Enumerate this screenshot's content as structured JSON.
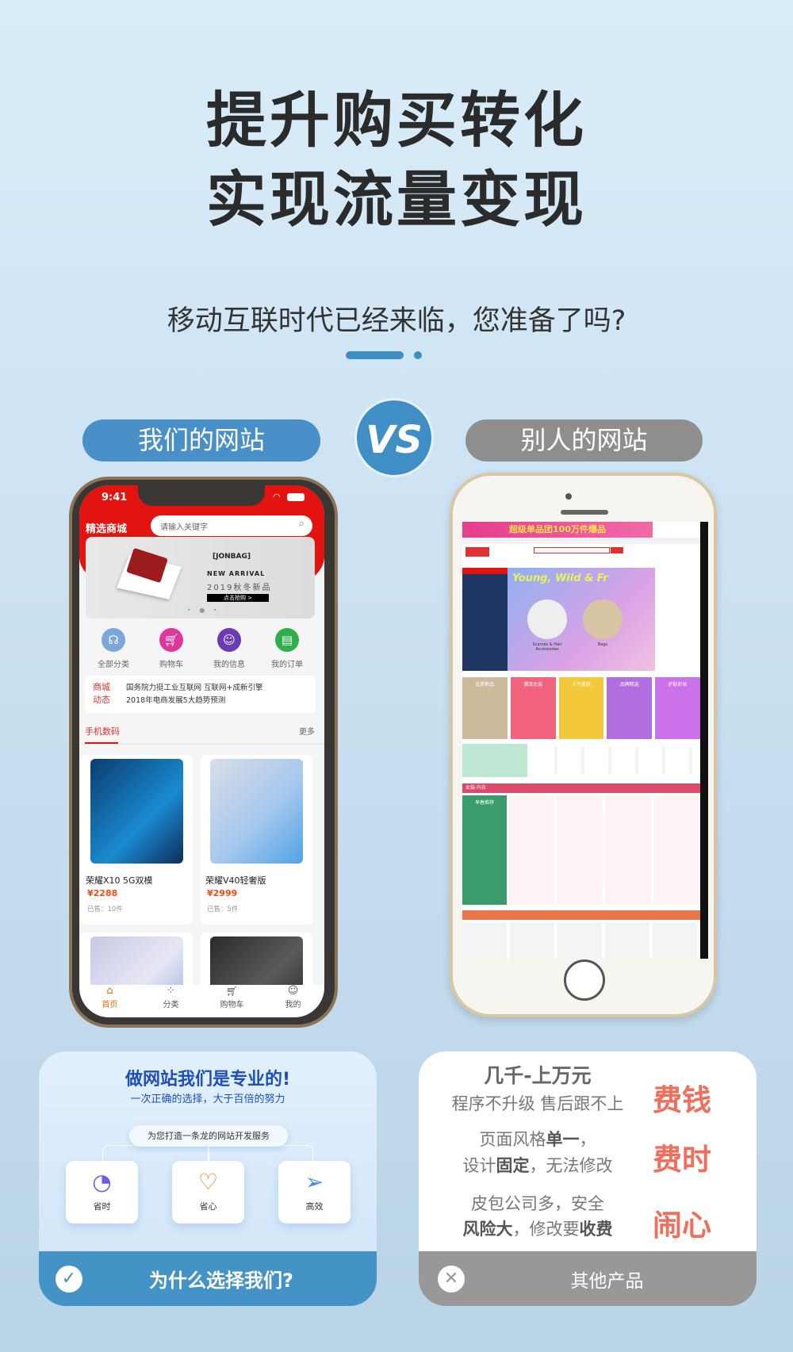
{
  "headline": {
    "line1": "提升购买转化",
    "line2": "实现流量变现",
    "subtitle": "移动互联时代已经来临，您准备了吗?"
  },
  "compare": {
    "ours_label": "我们的网站",
    "vs": "VS",
    "theirs_label": "别人的网站",
    "ours_color": "#4a90c8",
    "theirs_color": "#8e8e8e"
  },
  "our_phone": {
    "status_time": "9:41",
    "shop_title": "精选商城",
    "search_placeholder": "请输入关键字",
    "banner": {
      "brand": "[JONBAG]",
      "headline": "NEW ARRIVAL",
      "sub": "2019秋冬新品",
      "cta": "点击抢购 >"
    },
    "quick_links": [
      {
        "label": "全部分类",
        "icon": "headset-icon",
        "color": "#7ba7d9"
      },
      {
        "label": "购物车",
        "icon": "cart-icon",
        "color": "#e0359a"
      },
      {
        "label": "我的信息",
        "icon": "user-icon",
        "color": "#6a3bb5"
      },
      {
        "label": "我的订单",
        "icon": "order-icon",
        "color": "#2fae4a"
      }
    ],
    "news": {
      "tag_line1": "商城",
      "tag_line2": "动态",
      "items": [
        "国务院力挺工业互联网 互联网+成新引擎",
        "2018年电商发展5大趋势预测"
      ]
    },
    "section": {
      "title": "手机数码",
      "more": "更多"
    },
    "products": [
      {
        "name": "荣耀X10 5G双模",
        "price": "¥2288",
        "sold": "已售：10件"
      },
      {
        "name": "荣耀V40轻奢版",
        "price": "¥2999",
        "sold": "已售：5件"
      }
    ],
    "tabbar": [
      {
        "label": "首页",
        "icon": "home-icon",
        "active": true
      },
      {
        "label": "分类",
        "icon": "grid-icon"
      },
      {
        "label": "购物车",
        "icon": "cart-icon"
      },
      {
        "label": "我的",
        "icon": "user-icon"
      }
    ],
    "accent": "#e3140f"
  },
  "their_phone": {
    "top_banner": "超级单品团100万件爆品",
    "hero": "Young, Wild & Fr",
    "hero_items": [
      "Scarves & Hair Accessories",
      "Bags"
    ],
    "categories": [
      "优质新品",
      "潮流女装",
      "人气美鞋",
      "品牌精选",
      "护肤彩妆"
    ],
    "section2_title": "女装·内衣",
    "featured": "早春推荐"
  },
  "ours_card": {
    "title": "做网站我们是专业的!",
    "subtitle": "一次正确的选择，大于百倍的努力",
    "service": "为您打造一条龙的网站开发服务",
    "features": [
      {
        "label": "省时",
        "icon": "clock-icon"
      },
      {
        "label": "省心",
        "icon": "heart-hands-icon"
      },
      {
        "label": "高效",
        "icon": "paper-plane-icon"
      }
    ],
    "footer": "为什么选择我们?"
  },
  "theirs_card": {
    "rows": [
      {
        "line1": "几千-上万元",
        "line2": "程序不升级 售后跟不上",
        "verdict": "费钱"
      },
      {
        "line1a": "页面风格",
        "line1b": "单一",
        "line1c": "，",
        "line2a": "设计",
        "line2b": "固定",
        "line2c": "，无法修改",
        "verdict": "费时"
      },
      {
        "line1": "皮包公司多，安全",
        "line2a": "风险大",
        "line2b": "，修改要",
        "line2c": "收费",
        "verdict": "闹心"
      }
    ],
    "footer": "其他产品",
    "verdict_color": "#ef6e5c"
  }
}
